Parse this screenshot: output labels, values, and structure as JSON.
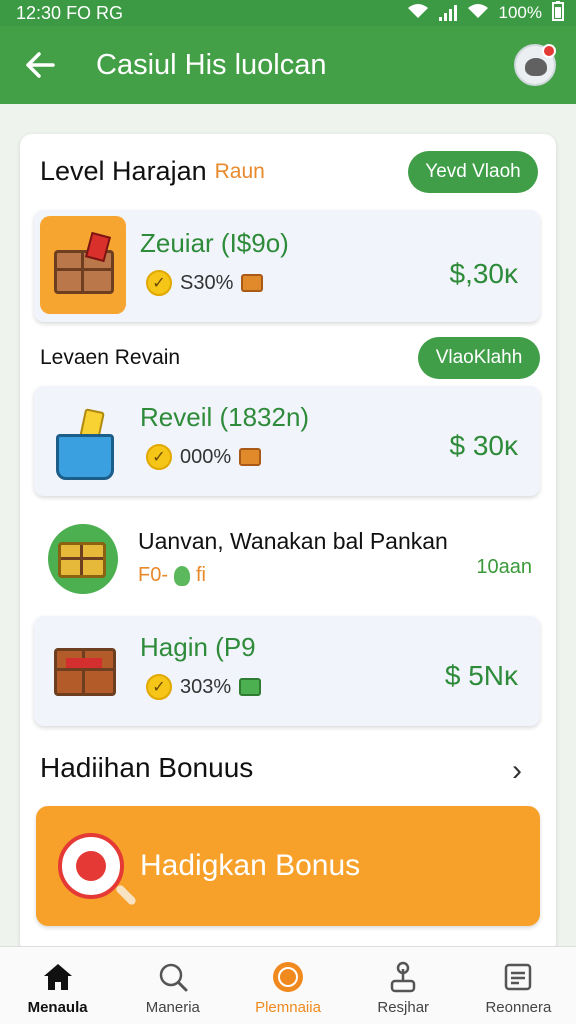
{
  "status": {
    "time": "12:30",
    "extra": "FO RG",
    "battery": "100%"
  },
  "appbar": {
    "title": "Casiul His luolcan"
  },
  "section1": {
    "title": "Level Harajan",
    "accent": "Raun",
    "pill": "Yevd Vlaoh"
  },
  "items": [
    {
      "name": "Zeuiar (I$9o)",
      "sub": "S30%",
      "price": "$,30ĸ"
    },
    {
      "name": "Reveil (1832n)",
      "sub": "000%",
      "price": "$ 30ĸ"
    },
    {
      "name": "Hagin (P9",
      "sub": "303%",
      "price": "$ 5Nĸ"
    }
  ],
  "section2": {
    "title": "Levaen Revain",
    "pill": "VlaoKlahh"
  },
  "plain": {
    "title": "Uanvan, Wanakan bal Pankan",
    "sub": "F0-",
    "sub_suffix": "fi",
    "right": "10aan"
  },
  "bonus": {
    "heading": "Hadiihan Bonuus",
    "button": "Hadigkan Bonus"
  },
  "nav": [
    {
      "label": "Menaula",
      "icon": "home-icon"
    },
    {
      "label": "Maneria",
      "icon": "search-icon"
    },
    {
      "label": "Plemnaiia",
      "icon": "coin-icon"
    },
    {
      "label": "Resjhar",
      "icon": "joystick-icon"
    },
    {
      "label": "Reonnera",
      "icon": "list-icon"
    }
  ]
}
